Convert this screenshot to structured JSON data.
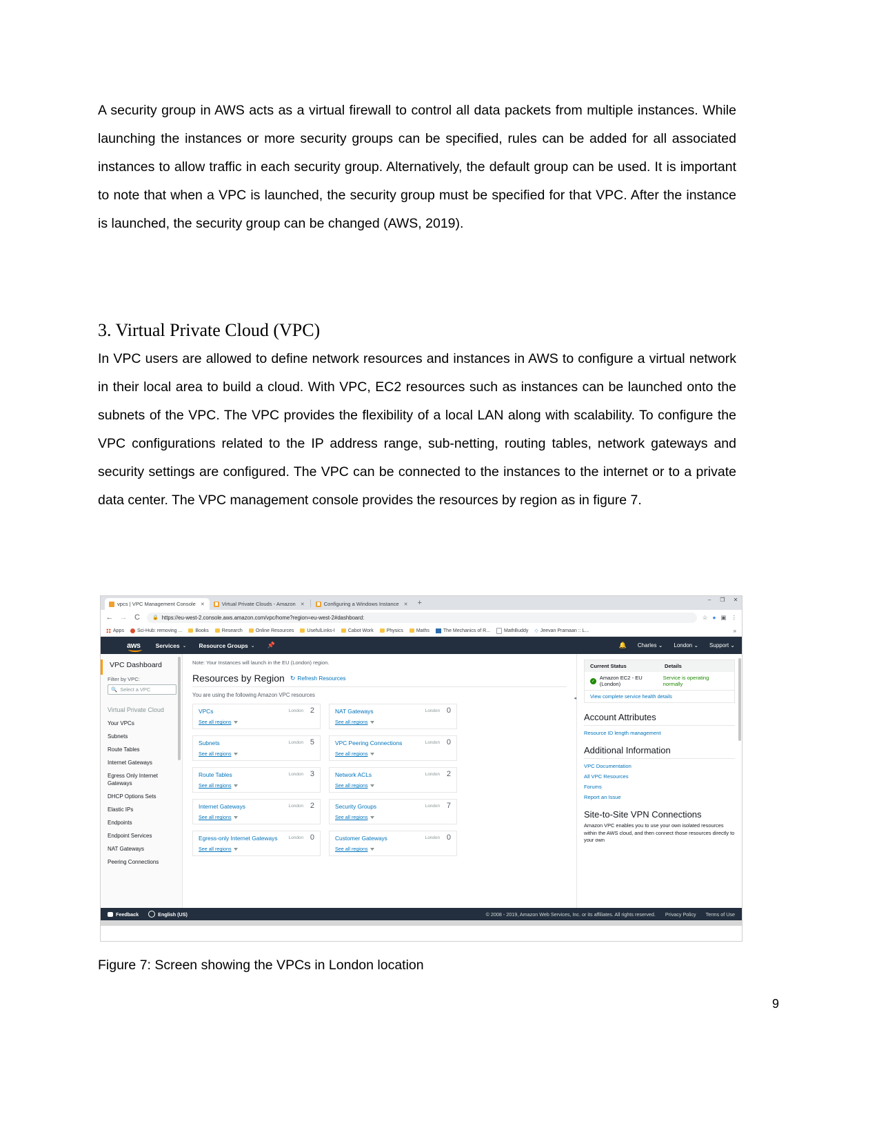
{
  "document": {
    "paragraph1": "A security group in AWS acts as a virtual firewall to control all data packets from multiple instances. While launching the instances or more security groups can be specified, rules can be added for all associated instances to allow traffic in each security group. Alternatively, the default group can be used. It is important to note that when a VPC is launched, the security group must be specified for that VPC. After the instance is launched, the security group can be changed (AWS, 2019).",
    "heading": "3. Virtual Private Cloud (VPC)",
    "paragraph2": "In VPC users are allowed to define network resources and instances in AWS to configure a virtual network in their local area to build a cloud. With VPC, EC2 resources such as instances can be launched onto the subnets of the VPC. The VPC provides the flexibility of a local LAN along with scalability. To configure the VPC configurations related to the IP address range, sub-netting, routing tables, network gateways and security settings are configured. The VPC can be connected to the instances to the internet or to a private data center.  The VPC management console provides the resources by region as in figure 7.",
    "figure_caption": "Figure 7: Screen showing the VPCs in London location",
    "page_number": "9"
  },
  "browser": {
    "tabs": [
      {
        "title": "vpcs | VPC Management Console",
        "close": "✕",
        "active": true
      },
      {
        "title": "Virtual Private Clouds - Amazon",
        "close": "✕",
        "active": false
      },
      {
        "title": "Configuring a Windows Instance",
        "close": "✕",
        "active": false
      }
    ],
    "new_tab": "+",
    "window_controls": {
      "minimize": "–",
      "maximize": "❐",
      "close": "✕"
    },
    "nav": {
      "back": "←",
      "forward": "→",
      "reload": "C"
    },
    "url": "https://eu-west-2.console.aws.amazon.com/vpc/home?region=eu-west-2#dashboard:",
    "lock": "🔒",
    "omni_icons": {
      "star": "☆",
      "profile": "●",
      "cast": "▣",
      "menu": "⋮"
    },
    "bookmarks": [
      "Apps",
      "Sci-Hub: removing ...",
      "Books",
      "Research",
      "Online Resources",
      "UsefulLinks-I",
      "Cabot Work",
      "Physics",
      "Maths",
      "The Mechanics of R...",
      "MathBuddy",
      "Jeevan Pramaan :: L..."
    ],
    "bookmarks_overflow": "»"
  },
  "aws_nav": {
    "logo": "aws",
    "services": "Services",
    "resource_groups": "Resource Groups",
    "pin_icon": "pin-icon",
    "bell_icon": "🔔",
    "account": "Charles",
    "region": "London",
    "support": "Support",
    "caret": "⌄"
  },
  "sidebar": {
    "title": "VPC Dashboard",
    "filter_label": "Filter by VPC:",
    "search_placeholder": "Select a VPC",
    "group_label": "Virtual Private Cloud",
    "items": [
      "Your VPCs",
      "Subnets",
      "Route Tables",
      "Internet Gateways",
      "Egress Only Internet Gateways",
      "DHCP Options Sets",
      "Elastic IPs",
      "Endpoints",
      "Endpoint Services",
      "NAT Gateways",
      "Peering Connections"
    ]
  },
  "main": {
    "note": "Note: Your Instances will launch in the EU (London) region.",
    "title": "Resources by Region",
    "refresh": "Refresh Resources",
    "using_text": "You are using the following Amazon VPC resources",
    "region_label": "London",
    "see_all": "See all regions",
    "cards": [
      {
        "name": "VPCs",
        "region": "London",
        "count": "2"
      },
      {
        "name": "NAT Gateways",
        "region": "London",
        "count": "0"
      },
      {
        "name": "Subnets",
        "region": "London",
        "count": "5"
      },
      {
        "name": "VPC Peering Connections",
        "region": "London",
        "count": "0"
      },
      {
        "name": "Route Tables",
        "region": "London",
        "count": "3"
      },
      {
        "name": "Network ACLs",
        "region": "London",
        "count": "2"
      },
      {
        "name": "Internet Gateways",
        "region": "London",
        "count": "2"
      },
      {
        "name": "Security Groups",
        "region": "London",
        "count": "7"
      },
      {
        "name": "Egress-only Internet Gateways",
        "region": "London",
        "count": "0"
      },
      {
        "name": "Customer Gateways",
        "region": "London",
        "count": "0"
      }
    ]
  },
  "right_panel": {
    "status_header_1": "Current Status",
    "status_header_2": "Details",
    "status_service": "Amazon EC2 - EU (London)",
    "status_detail": "Service is operating normally",
    "status_ok_icon": "✓",
    "health_link": "View complete service health details",
    "account_attributes_title": "Account Attributes",
    "account_attributes_link": "Resource ID length management",
    "additional_info_title": "Additional Information",
    "additional_links": [
      "VPC Documentation",
      "All VPC Resources",
      "Forums",
      "Report an Issue"
    ],
    "vpn_title": "Site-to-Site VPN Connections",
    "vpn_text": "Amazon VPC enables you to use your own isolated resources within the AWS cloud, and then connect those resources directly to your own"
  },
  "footer": {
    "feedback": "Feedback",
    "language": "English (US)",
    "copyright": "© 2008 - 2019, Amazon Web Services, Inc. or its affiliates. All rights reserved.",
    "privacy": "Privacy Policy",
    "terms": "Terms of Use"
  },
  "colors": {
    "aws_navy": "#232f3e",
    "aws_orange": "#ff9900",
    "link_blue": "#0073bb",
    "status_green": "#1e8900"
  }
}
